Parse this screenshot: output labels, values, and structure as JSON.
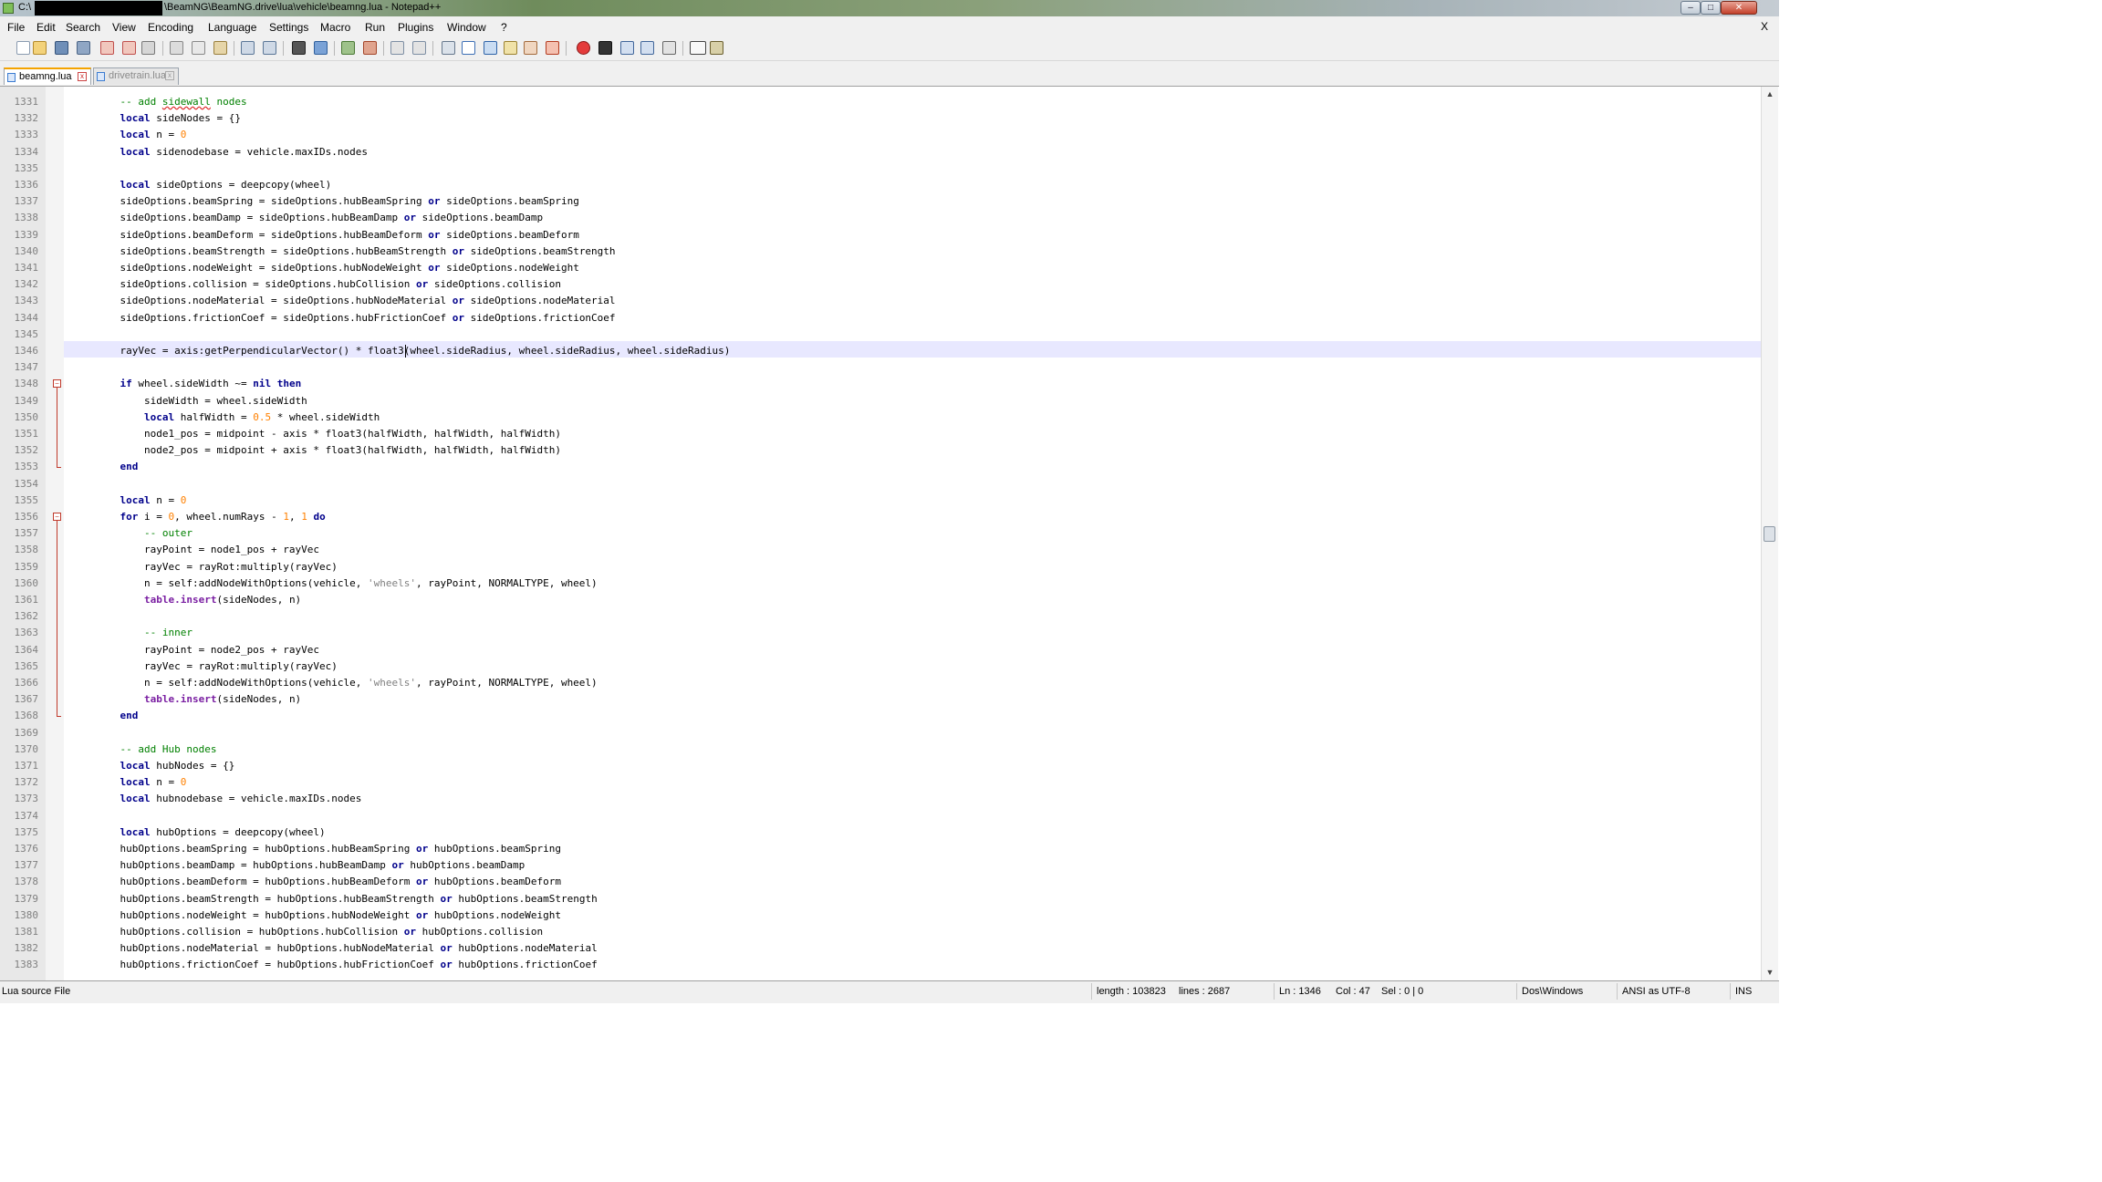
{
  "window": {
    "title_prefix": "C:\\",
    "title": "\\BeamNG\\BeamNG.drive\\lua\\vehicle\\beamng.lua - Notepad++",
    "minimize": "–",
    "maximize": "□",
    "close": "✕"
  },
  "menu": [
    "File",
    "Edit",
    "Search",
    "View",
    "Encoding",
    "Language",
    "Settings",
    "Macro",
    "Run",
    "Plugins",
    "Window",
    "?"
  ],
  "menu_close": "X",
  "toolbar_icons": [
    "new-file-icon",
    "open-file-icon",
    "save-icon",
    "save-all-icon",
    "close-icon",
    "close-all-icon",
    "print-icon",
    "cut-icon",
    "copy-icon",
    "paste-icon",
    "undo-icon",
    "redo-icon",
    "find-icon",
    "replace-icon",
    "zoom-in-icon",
    "zoom-out-icon",
    "sync-vertical-icon",
    "sync-horizontal-icon",
    "word-wrap-icon",
    "show-all-chars-icon",
    "indent-guide-icon",
    "udl-icon",
    "doc-map-icon",
    "function-list-icon",
    "folder-workspace-icon",
    "record-macro-icon",
    "stop-macro-icon",
    "play-macro-icon",
    "run-macro-multiple-icon",
    "save-macro-icon",
    "spellcheck-icon",
    "spellcheck-options-icon"
  ],
  "tabs": [
    {
      "label": "beamng.lua",
      "active": true
    },
    {
      "label": "drivetrain.lua",
      "active": false
    }
  ],
  "editor": {
    "current_line": 1346,
    "lines": [
      {
        "n": "1331",
        "code": "    -- add sidewall nodes"
      },
      {
        "n": "1332",
        "code": "    local sideNodes = {}"
      },
      {
        "n": "1333",
        "code": "    local n = 0"
      },
      {
        "n": "1334",
        "code": "    local sidenodebase = vehicle.maxIDs.nodes"
      },
      {
        "n": "1335",
        "code": ""
      },
      {
        "n": "1336",
        "code": "    local sideOptions = deepcopy(wheel)"
      },
      {
        "n": "1337",
        "code": "    sideOptions.beamSpring = sideOptions.hubBeamSpring or sideOptions.beamSpring"
      },
      {
        "n": "1338",
        "code": "    sideOptions.beamDamp = sideOptions.hubBeamDamp or sideOptions.beamDamp"
      },
      {
        "n": "1339",
        "code": "    sideOptions.beamDeform = sideOptions.hubBeamDeform or sideOptions.beamDeform"
      },
      {
        "n": "1340",
        "code": "    sideOptions.beamStrength = sideOptions.hubBeamStrength or sideOptions.beamStrength"
      },
      {
        "n": "1341",
        "code": "    sideOptions.nodeWeight = sideOptions.hubNodeWeight or sideOptions.nodeWeight"
      },
      {
        "n": "1342",
        "code": "    sideOptions.collision = sideOptions.hubCollision or sideOptions.collision"
      },
      {
        "n": "1343",
        "code": "    sideOptions.nodeMaterial = sideOptions.hubNodeMaterial or sideOptions.nodeMaterial"
      },
      {
        "n": "1344",
        "code": "    sideOptions.frictionCoef = sideOptions.hubFrictionCoef or sideOptions.frictionCoef"
      },
      {
        "n": "1345",
        "code": ""
      },
      {
        "n": "1346",
        "code": "    rayVec = axis:getPerpendicularVector() * float3(wheel.sideRadius, wheel.sideRadius, wheel.sideRadius)"
      },
      {
        "n": "1347",
        "code": ""
      },
      {
        "n": "1348",
        "code": "    if wheel.sideWidth ~= nil then"
      },
      {
        "n": "1349",
        "code": "        sideWidth = wheel.sideWidth"
      },
      {
        "n": "1350",
        "code": "        local halfWidth = 0.5 * wheel.sideWidth"
      },
      {
        "n": "1351",
        "code": "        node1_pos = midpoint - axis * float3(halfWidth, halfWidth, halfWidth)"
      },
      {
        "n": "1352",
        "code": "        node2_pos = midpoint + axis * float3(halfWidth, halfWidth, halfWidth)"
      },
      {
        "n": "1353",
        "code": "    end"
      },
      {
        "n": "1354",
        "code": ""
      },
      {
        "n": "1355",
        "code": "    local n = 0"
      },
      {
        "n": "1356",
        "code": "    for i = 0, wheel.numRays - 1, 1 do"
      },
      {
        "n": "1357",
        "code": "        -- outer"
      },
      {
        "n": "1358",
        "code": "        rayPoint = node1_pos + rayVec"
      },
      {
        "n": "1359",
        "code": "        rayVec = rayRot:multiply(rayVec)"
      },
      {
        "n": "1360",
        "code": "        n = self:addNodeWithOptions(vehicle, 'wheels', rayPoint, NORMALTYPE, wheel)"
      },
      {
        "n": "1361",
        "code": "        table.insert(sideNodes, n)"
      },
      {
        "n": "1362",
        "code": ""
      },
      {
        "n": "1363",
        "code": "        -- inner"
      },
      {
        "n": "1364",
        "code": "        rayPoint = node2_pos + rayVec"
      },
      {
        "n": "1365",
        "code": "        rayVec = rayRot:multiply(rayVec)"
      },
      {
        "n": "1366",
        "code": "        n = self:addNodeWithOptions(vehicle, 'wheels', rayPoint, NORMALTYPE, wheel)"
      },
      {
        "n": "1367",
        "code": "        table.insert(sideNodes, n)"
      },
      {
        "n": "1368",
        "code": "    end"
      },
      {
        "n": "1369",
        "code": ""
      },
      {
        "n": "1370",
        "code": "    -- add Hub nodes"
      },
      {
        "n": "1371",
        "code": "    local hubNodes = {}"
      },
      {
        "n": "1372",
        "code": "    local n = 0"
      },
      {
        "n": "1373",
        "code": "    local hubnodebase = vehicle.maxIDs.nodes"
      },
      {
        "n": "1374",
        "code": ""
      },
      {
        "n": "1375",
        "code": "    local hubOptions = deepcopy(wheel)"
      },
      {
        "n": "1376",
        "code": "    hubOptions.beamSpring = hubOptions.hubBeamSpring or hubOptions.beamSpring"
      },
      {
        "n": "1377",
        "code": "    hubOptions.beamDamp = hubOptions.hubBeamDamp or hubOptions.beamDamp"
      },
      {
        "n": "1378",
        "code": "    hubOptions.beamDeform = hubOptions.hubBeamDeform or hubOptions.beamDeform"
      },
      {
        "n": "1379",
        "code": "    hubOptions.beamStrength = hubOptions.hubBeamStrength or hubOptions.beamStrength"
      },
      {
        "n": "1380",
        "code": "    hubOptions.nodeWeight = hubOptions.hubNodeWeight or hubOptions.nodeWeight"
      },
      {
        "n": "1381",
        "code": "    hubOptions.collision = hubOptions.hubCollision or hubOptions.collision"
      },
      {
        "n": "1382",
        "code": "    hubOptions.nodeMaterial = hubOptions.hubNodeMaterial or hubOptions.nodeMaterial"
      },
      {
        "n": "1383",
        "code": "    hubOptions.frictionCoef = hubOptions.hubFrictionCoef or hubOptions.frictionCoef"
      }
    ],
    "fold_markers": [
      "1348",
      "1356"
    ],
    "fold_ends": [
      "1353",
      "1368"
    ]
  },
  "statusbar": {
    "file_type": "Lua source File",
    "length": "length : 103823",
    "lines": "lines : 2687",
    "ln": "Ln : 1346",
    "col": "Col : 47",
    "sel": "Sel : 0 | 0",
    "eol": "Dos\\Windows",
    "encoding": "ANSI as UTF-8",
    "mode": "INS"
  },
  "colors": {
    "keyword": "#00008b",
    "number": "#ff8000",
    "comment": "#008000",
    "string": "#808080",
    "current_line": "#e8e8ff",
    "active_tab_accent": "#f4a300"
  }
}
